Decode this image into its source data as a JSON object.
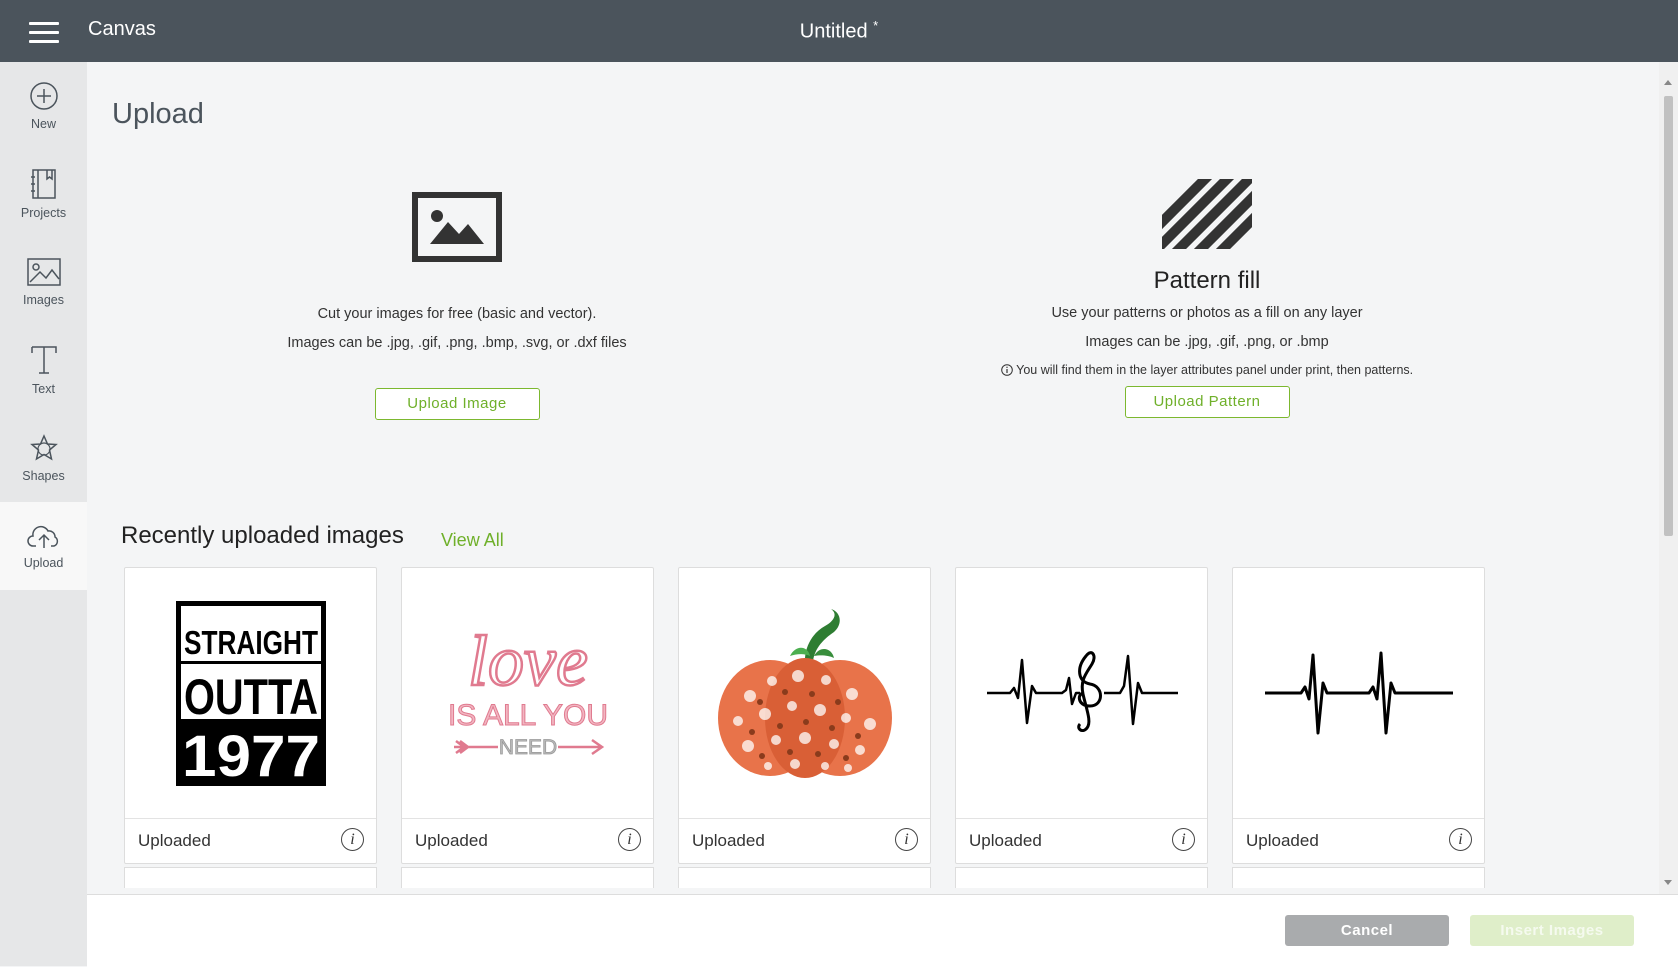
{
  "header": {
    "app_name": "Canvas",
    "doc_title": "Untitled",
    "unsaved_marker": "*"
  },
  "sidebar": {
    "items": [
      {
        "label": "New",
        "icon": "plus-circle-icon"
      },
      {
        "label": "Projects",
        "icon": "projects-icon"
      },
      {
        "label": "Images",
        "icon": "images-icon"
      },
      {
        "label": "Text",
        "icon": "text-icon"
      },
      {
        "label": "Shapes",
        "icon": "shapes-icon"
      },
      {
        "label": "Upload",
        "icon": "cloud-upload-icon",
        "active": true
      }
    ]
  },
  "page": {
    "title": "Upload",
    "upload_image": {
      "line1": "Cut your images for free (basic and vector).",
      "line2": "Images can be .jpg, .gif, .png, .bmp, .svg, or .dxf files",
      "button": "Upload Image"
    },
    "pattern_fill": {
      "heading": "Pattern fill",
      "line1": "Use your patterns or photos as a fill on any layer",
      "line2": "Images can be .jpg, .gif, .png, or .bmp",
      "note": "You will find them in the layer attributes panel under print, then patterns.",
      "button": "Upload Pattern"
    },
    "recent": {
      "title": "Recently uploaded images",
      "view_all": "View All",
      "cards": [
        {
          "label": "Uploaded",
          "image": "straight-outta-1977",
          "t1": "STRAIGHT",
          "t2": "OUTTA",
          "t3": "1977"
        },
        {
          "label": "Uploaded",
          "image": "love-is-all-you-need",
          "t1": "love",
          "t2": "IS ALL YOU",
          "t3": "NEED"
        },
        {
          "label": "Uploaded",
          "image": "paisley-pumpkin"
        },
        {
          "label": "Uploaded",
          "image": "heartbeat-treble-clef"
        },
        {
          "label": "Uploaded",
          "image": "heartbeat-line"
        }
      ]
    }
  },
  "footer": {
    "cancel": "Cancel",
    "insert": "Insert Images"
  },
  "colors": {
    "topbar": "#4b545c",
    "accent": "#7cb82f",
    "sidebar": "#e6e7e8",
    "cancel": "#a9abad",
    "insert_disabled": "#dfeec9",
    "pink": "#e07a8f",
    "pumpkin": "#e8734a"
  }
}
